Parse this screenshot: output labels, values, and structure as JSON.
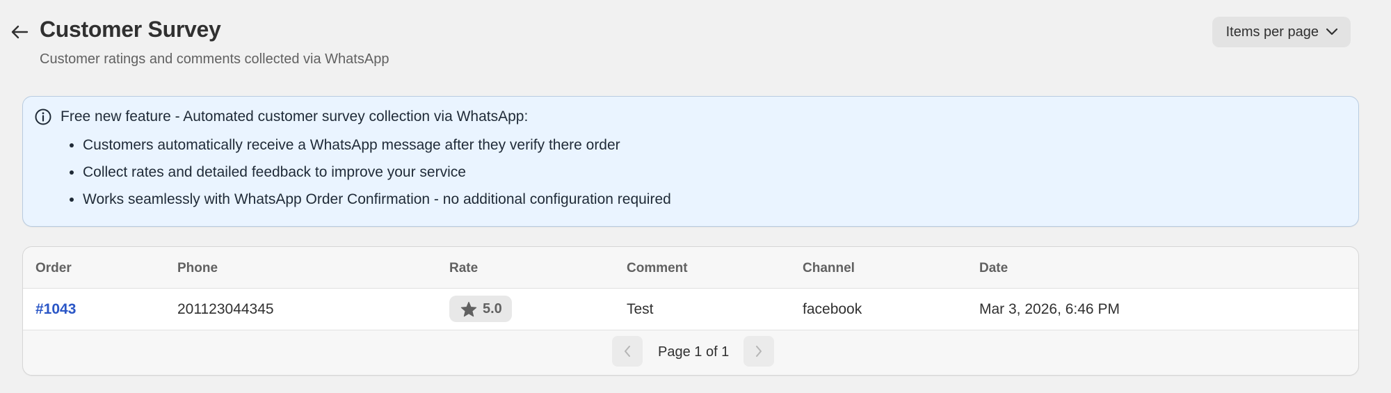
{
  "header": {
    "title": "Customer Survey",
    "subtitle": "Customer ratings and comments collected via WhatsApp",
    "items_per_page_label": "Items per page"
  },
  "banner": {
    "headline": "Free new feature - Automated customer survey collection via WhatsApp:",
    "bullets": [
      "Customers automatically receive a WhatsApp message after they verify there order",
      "Collect rates and detailed feedback to improve your service",
      "Works seamlessly with WhatsApp Order Confirmation - no additional configuration required"
    ]
  },
  "table": {
    "columns": [
      "Order",
      "Phone",
      "Rate",
      "Comment",
      "Channel",
      "Date"
    ],
    "rows": [
      {
        "order": "#1043",
        "phone": "201123044345",
        "rate": "5.0",
        "comment": "Test",
        "channel": "facebook",
        "date": "Mar 3, 2026, 6:46 PM"
      }
    ]
  },
  "pagination": {
    "label": "Page 1 of 1"
  },
  "icons": {
    "back": "arrow-left-icon",
    "dropdown": "chevron-down-icon",
    "info": "info-icon",
    "rating": "star-icon",
    "prev": "chevron-left-icon",
    "next": "chevron-right-icon"
  },
  "colors": {
    "background": "#f1f1f1",
    "banner_bg": "#eaf4ff",
    "link": "#2a56c6",
    "text": "#303030"
  }
}
